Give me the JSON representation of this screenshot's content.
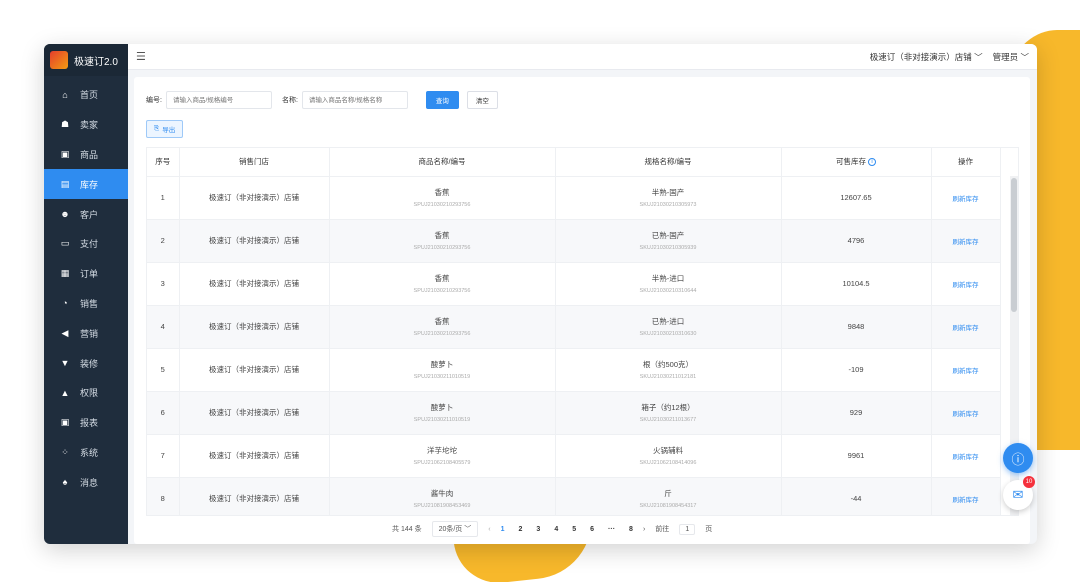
{
  "app": {
    "title": "极速订2.0"
  },
  "sidebar": {
    "items": [
      {
        "label": "首页",
        "icon": "home-icon",
        "glyph": "⌂",
        "active": false
      },
      {
        "label": "卖家",
        "icon": "seller-icon",
        "glyph": "☗",
        "active": false
      },
      {
        "label": "商品",
        "icon": "goods-icon",
        "glyph": "▣",
        "active": false
      },
      {
        "label": "库存",
        "icon": "inventory-icon",
        "glyph": "▤",
        "active": true
      },
      {
        "label": "客户",
        "icon": "customer-icon",
        "glyph": "☻",
        "active": false
      },
      {
        "label": "支付",
        "icon": "payment-icon",
        "glyph": "▭",
        "active": false
      },
      {
        "label": "订单",
        "icon": "order-icon",
        "glyph": "▦",
        "active": false
      },
      {
        "label": "销售",
        "icon": "sales-icon",
        "glyph": "◔",
        "active": false
      },
      {
        "label": "营销",
        "icon": "marketing-icon",
        "glyph": "◀",
        "active": false
      },
      {
        "label": "装修",
        "icon": "decoration-icon",
        "glyph": "▼",
        "active": false
      },
      {
        "label": "权限",
        "icon": "lock-icon",
        "glyph": "▲",
        "active": false
      },
      {
        "label": "报表",
        "icon": "report-icon",
        "glyph": "▣",
        "active": false
      },
      {
        "label": "系统",
        "icon": "system-icon",
        "glyph": "⁘",
        "active": false
      },
      {
        "label": "消息",
        "icon": "bell-icon",
        "glyph": "♠",
        "active": false
      }
    ]
  },
  "topbar": {
    "menu_toggle_glyph": "☰",
    "store": "极速订（非对接演示）店铺 ﹀",
    "user": "管理员 ﹀"
  },
  "filters": {
    "code_label": "编号:",
    "code_placeholder": "请输入商品/规格编号",
    "name_label": "名称:",
    "name_placeholder": "请输入商品名称/规格名称",
    "search_label": "查询",
    "clear_label": "清空",
    "export_label": "导出"
  },
  "table": {
    "headers": {
      "index": "序号",
      "store": "销售门店",
      "product": "商品名称/编号",
      "spec": "规格名称/编号",
      "stock": "可售库存",
      "action": "操作"
    },
    "rows": [
      {
        "index": "1",
        "store": "极速订（非对接演示）店铺",
        "product_name": "香蕉",
        "product_code": "SPUJ21030210293756",
        "spec_name": "半熟-国产",
        "spec_code": "SKUJ21030210305973",
        "stock": "12607.65",
        "action": "刷新库存"
      },
      {
        "index": "2",
        "store": "极速订（非对接演示）店铺",
        "product_name": "香蕉",
        "product_code": "SPUJ21030210293756",
        "spec_name": "已熟-国产",
        "spec_code": "SKUJ21030210305939",
        "stock": "4796",
        "action": "刷新库存"
      },
      {
        "index": "3",
        "store": "极速订（非对接演示）店铺",
        "product_name": "香蕉",
        "product_code": "SPUJ21030210293756",
        "spec_name": "半熟-进口",
        "spec_code": "SKUJ21030210310644",
        "stock": "10104.5",
        "action": "刷新库存"
      },
      {
        "index": "4",
        "store": "极速订（非对接演示）店铺",
        "product_name": "香蕉",
        "product_code": "SPUJ21030210293756",
        "spec_name": "已熟-进口",
        "spec_code": "SKUJ21030210310630",
        "stock": "9848",
        "action": "刷新库存"
      },
      {
        "index": "5",
        "store": "极速订（非对接演示）店铺",
        "product_name": "酸萝卜",
        "product_code": "SPUJ21030211010519",
        "spec_name": "根（约500克）",
        "spec_code": "SKUJ21030211012181",
        "stock": "-109",
        "action": "刷新库存"
      },
      {
        "index": "6",
        "store": "极速订（非对接演示）店铺",
        "product_name": "酸萝卜",
        "product_code": "SPUJ21030211010519",
        "spec_name": "箱子（约12根）",
        "spec_code": "SKUJ21030211013677",
        "stock": "929",
        "action": "刷新库存"
      },
      {
        "index": "7",
        "store": "极速订（非对接演示）店铺",
        "product_name": "洋芋坨坨",
        "product_code": "SPUJ21062108405579",
        "spec_name": "火锅辅料",
        "spec_code": "SKUJ21062108414096",
        "stock": "9961",
        "action": "刷新库存"
      },
      {
        "index": "8",
        "store": "极速订（非对接演示）店铺",
        "product_name": "酱牛肉",
        "product_code": "SPUJ21081908453469",
        "spec_name": "斤",
        "spec_code": "SKUJ21081908454317",
        "stock": "-44",
        "action": "刷新库存"
      }
    ]
  },
  "pagination": {
    "total": "共 144 条",
    "page_size": "20条/页 ﹀",
    "prev": "‹",
    "pages": [
      "1",
      "2",
      "3",
      "4",
      "5",
      "6",
      "···",
      "8"
    ],
    "active_page": "1",
    "next": "›",
    "goto_label": "前往",
    "goto_value": "1",
    "goto_suffix": "页"
  },
  "notifications": {
    "badge": "10"
  },
  "colors": {
    "primary": "#2f8cf0",
    "sidebar": "#1f2d3d",
    "accent_yellow": "#f7b82b"
  }
}
